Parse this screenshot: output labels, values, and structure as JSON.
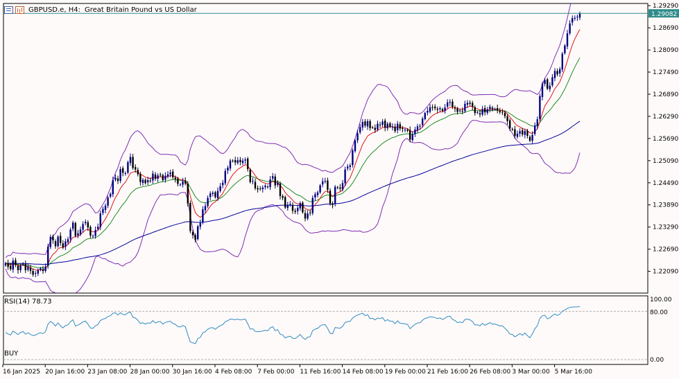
{
  "header": {
    "symbol": "GBPUSD.e, H4:",
    "description": "Great Britain Pound vs US Dollar",
    "icons": [
      "tile-windows-icon",
      "bar-chart-icon"
    ]
  },
  "rsi": {
    "label": "RSI(14) 78.73",
    "levels": [
      "100.00",
      "80.00",
      "0.00"
    ]
  },
  "signal": "BUY",
  "price_box": "1.29082",
  "colors": {
    "bull": "#000080",
    "bear": "#000000",
    "ma_fast": "#dc1414",
    "ma_mid": "#1e8c1e",
    "ma_slow": "#000099",
    "bollinger": "#7d2db4",
    "rsi_line": "#2f8bc0",
    "price_line": "#2e8b8b"
  },
  "chart_data": {
    "type": "candlestick",
    "title": "GBPUSD.e, H4:  Great Britain Pound vs US Dollar",
    "y_ticks": [
      "1.29290",
      "1.28690",
      "1.28090",
      "1.27490",
      "1.26890",
      "1.26290",
      "1.25690",
      "1.25090",
      "1.24490",
      "1.23890",
      "1.23290",
      "1.22690",
      "1.22090"
    ],
    "ylim": [
      1.215,
      1.2935
    ],
    "x_ticks": [
      "16 Jan 2025",
      "20 Jan 16:00",
      "23 Jan 08:00",
      "28 Jan 00:00",
      "30 Jan 16:00",
      "4 Feb 08:00",
      "7 Feb 00:00",
      "11 Feb 16:00",
      "14 Feb 08:00",
      "19 Feb 00:00",
      "21 Feb 16:00",
      "26 Feb 08:00",
      "3 Mar 00:00",
      "5 Mar 16:00"
    ],
    "current_price": 1.29082,
    "closes": [
      1.2231,
      1.2221,
      1.2215,
      1.2238,
      1.2226,
      1.2212,
      1.2225,
      1.223,
      1.2212,
      1.2221,
      1.221,
      1.22,
      1.2204,
      1.2212,
      1.2217,
      1.221,
      1.2222,
      1.2276,
      1.2302,
      1.2293,
      1.2277,
      1.2303,
      1.2286,
      1.2274,
      1.229,
      1.2296,
      1.2322,
      1.2341,
      1.2305,
      1.2312,
      1.2322,
      1.2337,
      1.2343,
      1.2328,
      1.2306,
      1.2305,
      1.2321,
      1.233,
      1.2366,
      1.2378,
      1.2387,
      1.2409,
      1.2419,
      1.2456,
      1.2463,
      1.2454,
      1.2486,
      1.2476,
      1.2475,
      1.2505,
      1.2519,
      1.2489,
      1.2485,
      1.2472,
      1.2451,
      1.2457,
      1.2448,
      1.2456,
      1.2454,
      1.2474,
      1.246,
      1.2469,
      1.2471,
      1.2456,
      1.2468,
      1.2472,
      1.2477,
      1.2464,
      1.2459,
      1.2446,
      1.2444,
      1.2453,
      1.2447,
      1.2393,
      1.2318,
      1.2307,
      1.2294,
      1.2331,
      1.234,
      1.2377,
      1.2386,
      1.2408,
      1.242,
      1.2422,
      1.241,
      1.2427,
      1.244,
      1.2449,
      1.2481,
      1.249,
      1.2509,
      1.2508,
      1.2504,
      1.251,
      1.2505,
      1.2509,
      1.2512,
      1.2486,
      1.2451,
      1.2454,
      1.2434,
      1.2431,
      1.2433,
      1.2436,
      1.2441,
      1.2437,
      1.2458,
      1.2467,
      1.2442,
      1.2449,
      1.2413,
      1.2408,
      1.2382,
      1.2388,
      1.2391,
      1.2373,
      1.237,
      1.2381,
      1.2394,
      1.2369,
      1.2352,
      1.2366,
      1.2368,
      1.2408,
      1.2418,
      1.2423,
      1.2442,
      1.2453,
      1.2454,
      1.243,
      1.2393,
      1.2389,
      1.2438,
      1.2435,
      1.2433,
      1.2448,
      1.2485,
      1.2493,
      1.2496,
      1.2537,
      1.2564,
      1.2583,
      1.26,
      1.2614,
      1.2604,
      1.2616,
      1.2597,
      1.2599,
      1.2592,
      1.2609,
      1.2606,
      1.2615,
      1.2598,
      1.2609,
      1.2601,
      1.2601,
      1.2589,
      1.2609,
      1.2596,
      1.2595,
      1.2593,
      1.259,
      1.2566,
      1.258,
      1.2593,
      1.2602,
      1.2603,
      1.2623,
      1.2638,
      1.2644,
      1.2654,
      1.2653,
      1.2651,
      1.2647,
      1.2651,
      1.2644,
      1.2653,
      1.2667,
      1.2668,
      1.2655,
      1.265,
      1.2641,
      1.2645,
      1.2642,
      1.2663,
      1.2666,
      1.2663,
      1.2655,
      1.2638,
      1.264,
      1.2634,
      1.2649,
      1.264,
      1.2648,
      1.2655,
      1.2649,
      1.2649,
      1.2645,
      1.264,
      1.2641,
      1.2629,
      1.2616,
      1.2596,
      1.2593,
      1.2576,
      1.2582,
      1.2589,
      1.258,
      1.2589,
      1.2576,
      1.2563,
      1.2579,
      1.2604,
      1.2621,
      1.2684,
      1.2717,
      1.2727,
      1.2704,
      1.2712,
      1.2735,
      1.2752,
      1.2743,
      1.2757,
      1.2799,
      1.2821,
      1.2854,
      1.2881,
      1.2895,
      1.2896,
      1.2899,
      1.2908
    ],
    "rsi": [
      45.1,
      42.4,
      40.8,
      47.4,
      44.6,
      41.5,
      45.2,
      46.5,
      42.2,
      44.5,
      41.9,
      39.6,
      40.8,
      43.2,
      44.6,
      43.0,
      46.5,
      58.9,
      63.3,
      60.4,
      55.6,
      60.9,
      56.0,
      52.6,
      56.3,
      57.7,
      62.9,
      66.1,
      55.8,
      57.2,
      59.5,
      62.6,
      63.8,
      58.9,
      52.4,
      52.0,
      56.0,
      58.0,
      65.1,
      67.0,
      68.4,
      71.5,
      72.8,
      76.9,
      77.7,
      74.0,
      77.8,
      74.8,
      74.5,
      77.6,
      78.9,
      70.2,
      69.0,
      65.3,
      59.8,
      61.2,
      58.9,
      60.9,
      60.4,
      64.8,
      60.7,
      62.7,
      63.2,
      58.9,
      61.7,
      62.6,
      63.8,
      59.9,
      58.4,
      54.7,
      54.1,
      56.6,
      54.6,
      41.2,
      29.1,
      27.8,
      26.4,
      35.0,
      36.9,
      44.6,
      46.3,
      50.4,
      52.6,
      53.0,
      50.4,
      53.8,
      56.2,
      57.9,
      63.0,
      64.5,
      67.2,
      66.9,
      66.1,
      67.1,
      65.9,
      66.6,
      67.1,
      59.5,
      50.5,
      51.2,
      46.8,
      46.2,
      46.7,
      47.4,
      48.6,
      47.7,
      52.7,
      54.7,
      48.1,
      49.8,
      41.9,
      40.9,
      36.0,
      37.9,
      38.7,
      35.5,
      35.0,
      38.0,
      41.7,
      36.6,
      33.3,
      37.2,
      37.8,
      48.3,
      50.6,
      51.7,
      55.7,
      57.8,
      58.0,
      51.8,
      43.7,
      42.9,
      53.2,
      52.5,
      52.1,
      55.0,
      61.6,
      62.9,
      63.4,
      68.8,
      72.0,
      74.0,
      75.6,
      76.9,
      72.9,
      74.6,
      68.0,
      68.5,
      66.0,
      68.8,
      68.2,
      69.6,
      63.8,
      66.3,
      63.7,
      63.7,
      59.5,
      64.4,
      60.2,
      59.9,
      59.3,
      58.3,
      51.3,
      55.1,
      58.6,
      60.8,
      61.0,
      65.4,
      68.3,
      69.4,
      71.2,
      70.6,
      69.8,
      68.2,
      69.2,
      66.4,
      68.6,
      71.6,
      71.9,
      66.7,
      64.8,
      61.3,
      62.4,
      61.2,
      66.5,
      67.2,
      66.0,
      63.1,
      57.3,
      57.9,
      55.9,
      60.0,
      57.0,
      59.2,
      61.3,
      59.0,
      59.1,
      57.6,
      55.8,
      56.2,
      51.9,
      47.7,
      42.4,
      41.7,
      37.8,
      40.3,
      43.2,
      40.3,
      44.1,
      39.8,
      36.2,
      42.6,
      51.3,
      56.2,
      68.4,
      72.6,
      73.6,
      67.6,
      69.2,
      73.0,
      75.6,
      73.3,
      75.4,
      80.3,
      82.3,
      84.9,
      86.5,
      87.2,
      87.3,
      87.5,
      87.9
    ]
  }
}
